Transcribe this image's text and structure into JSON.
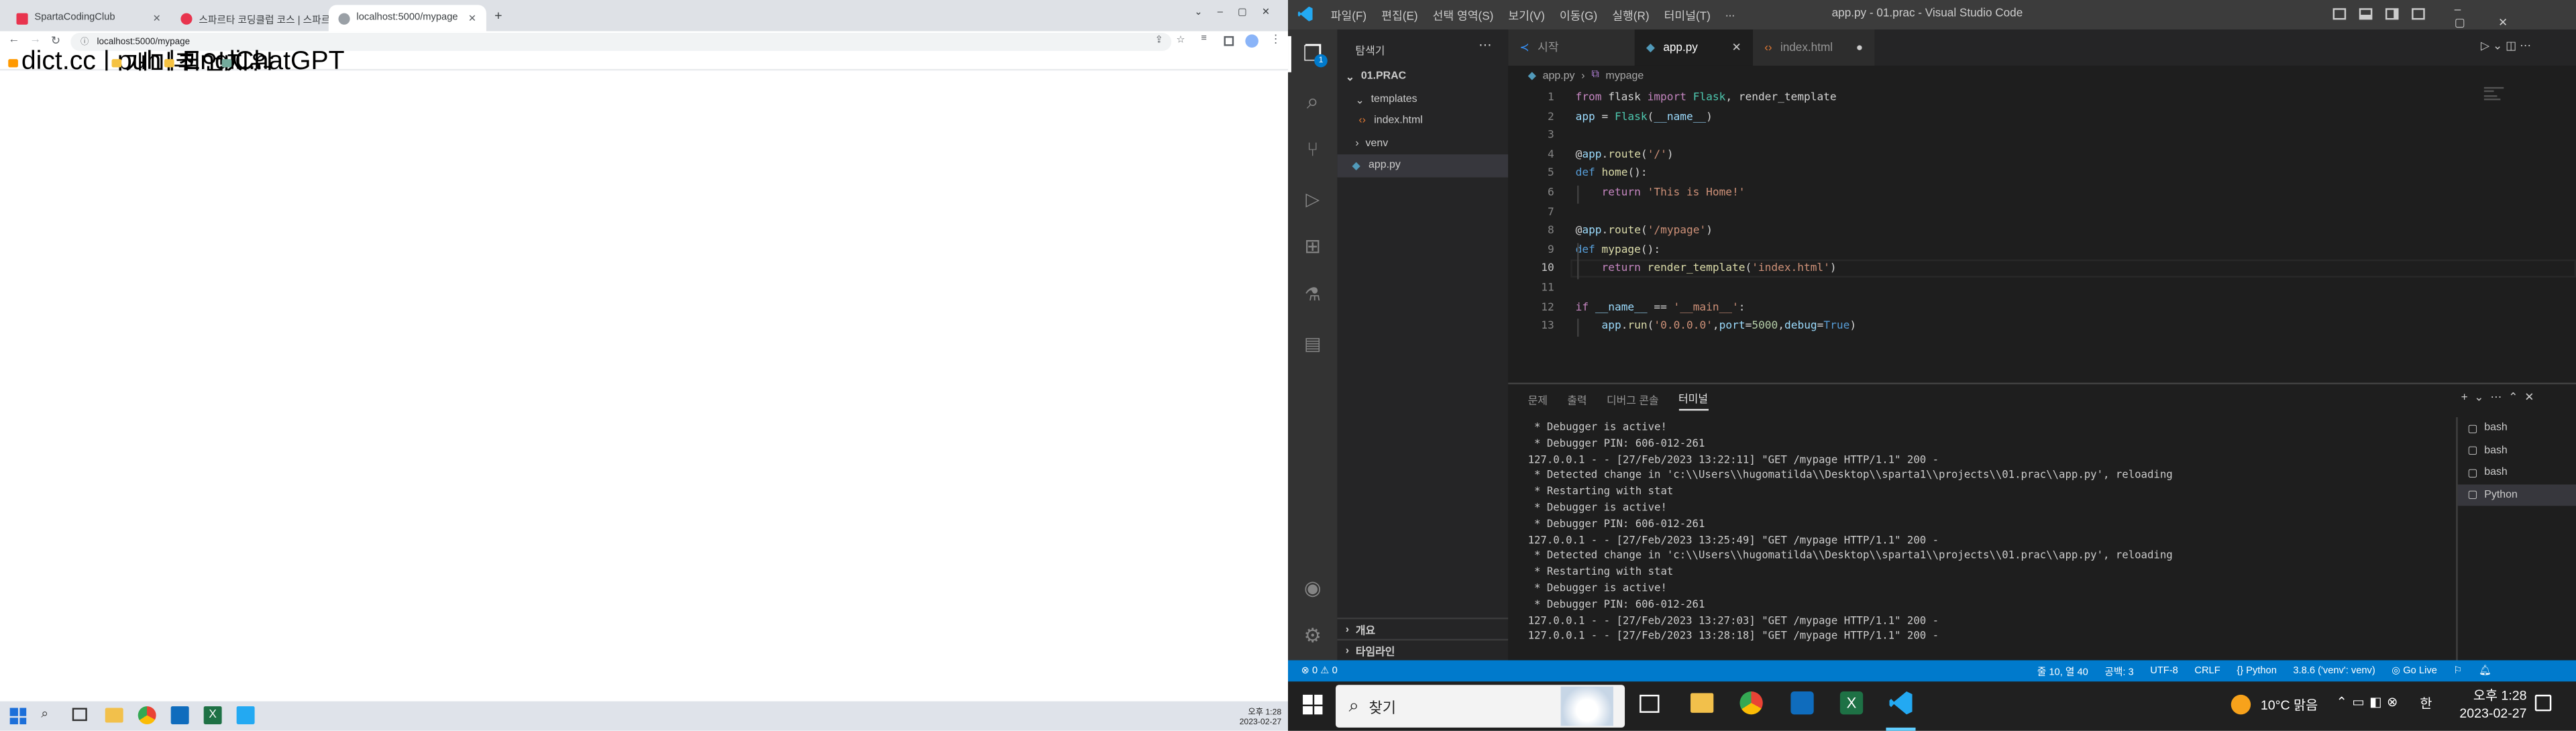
{
  "browser": {
    "tabs": [
      {
        "label": "SpartaCodingClub",
        "favicon_color": "#e8344e"
      },
      {
        "label": "스파르타 코딩클럽 코스 | 스파르타",
        "favicon_color": "#e8344e"
      },
      {
        "label": "localhost:5000/mypage",
        "favicon_color": "#9aa0a6"
      }
    ],
    "new_tab_icon": "plus-icon",
    "url": "localhost:5000/mypage",
    "bookmarks": [
      {
        "label": "dict.cc | puh | Engli...",
        "color": "#ff9900"
      },
      {
        "label": "개미쿠",
        "color": "#f5c242"
      },
      {
        "label": "취업지원",
        "color": "#f5c242"
      },
      {
        "label": "ChatGPT",
        "color": "#74aa9c"
      }
    ]
  },
  "left_taskbar": {
    "time": "오후 1:28",
    "date": "2023-02-27"
  },
  "vscode": {
    "menu": [
      "파일(F)",
      "편집(E)",
      "선택 영역(S)",
      "보기(V)",
      "이동(G)",
      "실행(R)",
      "터미널(T)",
      "..."
    ],
    "window_title": "app.py - 01.prac - Visual Studio Code",
    "explorer": {
      "header": "탐색기",
      "root": "01.PRAC",
      "items": [
        "templates",
        "index.html",
        "venv",
        "app.py"
      ],
      "outline": "개요",
      "timeline": "타임라인"
    },
    "tabs": [
      {
        "label": "시작"
      },
      {
        "label": "app.py"
      },
      {
        "label": "index.html"
      }
    ],
    "breadcrumb": {
      "file": "app.py",
      "symbol": "mypage"
    },
    "code_lines": [
      "from flask import Flask, render_template",
      "app = Flask(__name__)",
      "",
      "@app.route('/')",
      "def home():",
      "    return 'This is Home!'",
      "",
      "@app.route('/mypage')",
      "def mypage():",
      "    return render_template('index.html')",
      "",
      "if __name__ == '__main__':",
      "    app.run('0.0.0.0',port=5000,debug=True)"
    ],
    "line_numbers": [
      "1",
      "2",
      "3",
      "4",
      "5",
      "6",
      "7",
      "8",
      "9",
      "10",
      "11",
      "12",
      "13"
    ],
    "panel_tabs": [
      "문제",
      "출력",
      "디버그 콘솔",
      "터미널"
    ],
    "terminal_lines": [
      " * Debugger is active!",
      " * Debugger PIN: 606-012-261",
      "127.0.0.1 - - [27/Feb/2023 13:22:11] \"GET /mypage HTTP/1.1\" 200 -",
      " * Detected change in 'c:\\\\Users\\\\hugomatilda\\\\Desktop\\\\sparta1\\\\projects\\\\01.prac\\\\app.py', reloading",
      " * Restarting with stat",
      " * Debugger is active!",
      " * Debugger PIN: 606-012-261",
      "127.0.0.1 - - [27/Feb/2023 13:25:49] \"GET /mypage HTTP/1.1\" 200 -",
      " * Detected change in 'c:\\\\Users\\\\hugomatilda\\\\Desktop\\\\sparta1\\\\projects\\\\01.prac\\\\app.py', reloading",
      " * Restarting with stat",
      " * Debugger is active!",
      " * Debugger PIN: 606-012-261",
      "127.0.0.1 - - [27/Feb/2023 13:27:03] \"GET /mypage HTTP/1.1\" 200 -",
      "127.0.0.1 - - [27/Feb/2023 13:28:18] \"GET /mypage HTTP/1.1\" 200 -"
    ],
    "terminals": [
      "bash",
      "bash",
      "bash",
      "Python"
    ],
    "status": {
      "errors": "0",
      "warnings": "0",
      "position": "줄 10, 열 40",
      "spaces": "공백: 3",
      "encoding": "UTF-8",
      "eol": "CRLF",
      "language": "Python",
      "interpreter": "3.8.6 ('venv': venv)",
      "golive": "Go Live"
    }
  },
  "taskbar": {
    "search_placeholder": "찾기",
    "weather": "10°C 맑음",
    "ime": "한",
    "time": "오후 1:28",
    "date": "2023-02-27"
  }
}
